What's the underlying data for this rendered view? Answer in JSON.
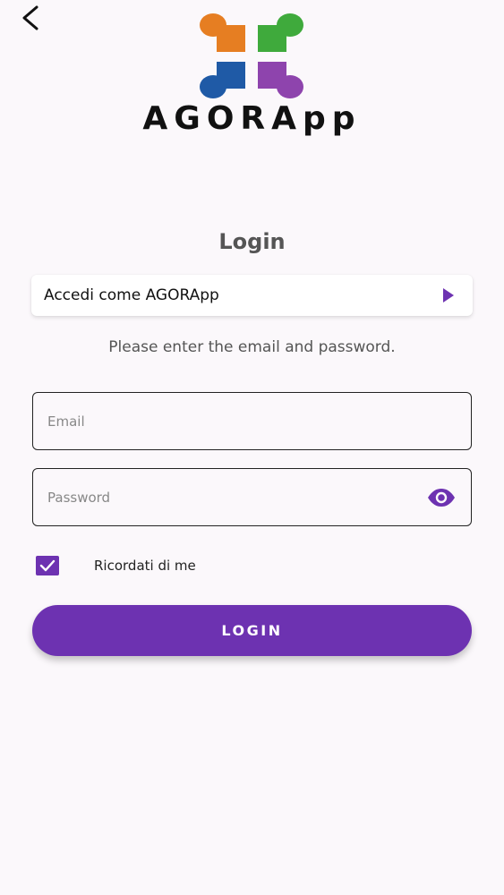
{
  "app": {
    "logo_text": "AGORApp",
    "logo_colors": {
      "orange": "#e67e22",
      "green": "#3faa3c",
      "blue": "#1f5aa6",
      "purple": "#8e44ad"
    }
  },
  "header": {
    "back_icon": "chevron-left-icon"
  },
  "login": {
    "title": "Login",
    "account_selector_label": "Accedi come AGORApp",
    "account_selector_icon": "play-triangle-icon",
    "instructions": "Please enter the email and password.",
    "email_placeholder": "Email",
    "email_value": "",
    "password_placeholder": "Password",
    "password_value": "",
    "password_toggle_icon": "eye-icon",
    "remember_me_label": "Ricordati di me",
    "remember_me_checked": true,
    "submit_label": "LOGIN",
    "accent_color": "#6d32b1"
  }
}
